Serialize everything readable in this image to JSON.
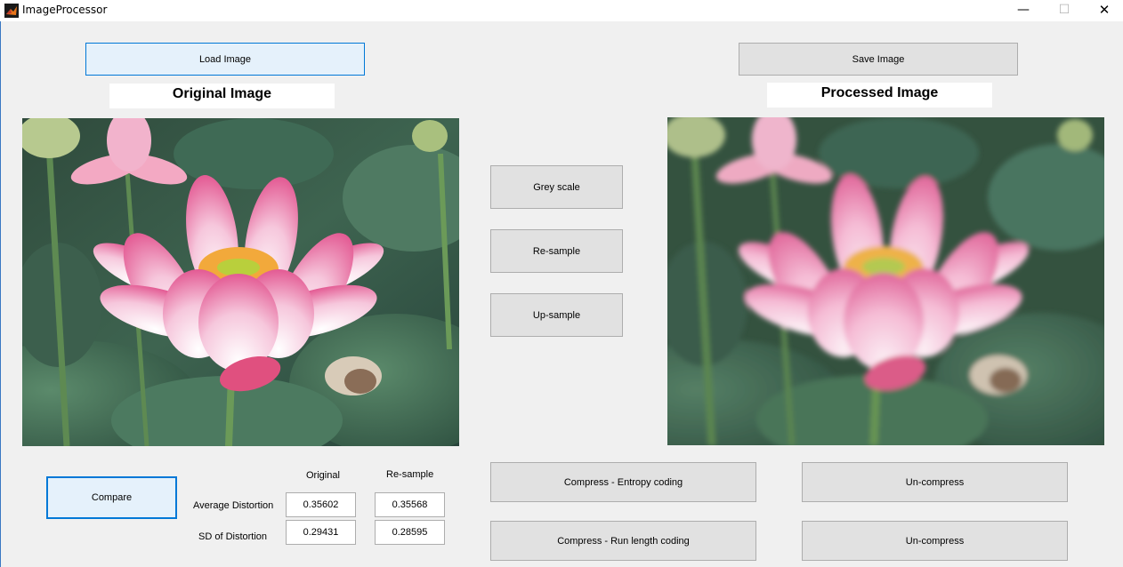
{
  "window": {
    "title": "ImageProcessor",
    "minimize": "—",
    "maximize": "☐",
    "close": "✕"
  },
  "buttons": {
    "load": "Load Image",
    "save": "Save Image",
    "grey_scale": "Grey scale",
    "re_sample": "Re-sample",
    "up_sample": "Up-sample",
    "compare": "Compare",
    "compress_entropy": "Compress - Entropy coding",
    "uncompress_entropy": "Un-compress",
    "compress_rle": "Compress - Run length coding",
    "uncompress_rle": "Un-compress"
  },
  "headings": {
    "original": "Original Image",
    "processed": "Processed Image"
  },
  "images": {
    "original_subject": "pink-lotus-flower",
    "processed_subject": "pink-lotus-flower-pixelated"
  },
  "stats": {
    "col_original": "Original",
    "col_resample": "Re-sample",
    "row_avg": "Average Distortion",
    "row_sd": "SD of Distortion",
    "avg_original": "0.35602",
    "avg_resample": "0.35568",
    "sd_original": "0.29431",
    "sd_resample": "0.28595"
  },
  "colors": {
    "accent": "#0078d7",
    "button_bg": "#e1e1e1",
    "window_bg": "#f0f0f0"
  }
}
